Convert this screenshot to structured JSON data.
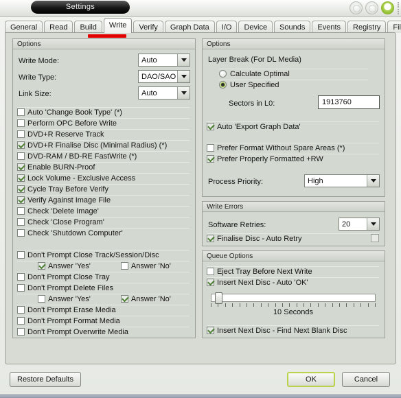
{
  "window": {
    "title": "Settings",
    "controls": [
      {
        "name": "minimize",
        "glyph": ""
      },
      {
        "name": "maximize",
        "glyph": ""
      },
      {
        "name": "close",
        "glyph": "✖"
      }
    ]
  },
  "tabs": [
    {
      "label": "General",
      "active": false
    },
    {
      "label": "Read",
      "active": false
    },
    {
      "label": "Build",
      "active": false
    },
    {
      "label": "Write",
      "active": true
    },
    {
      "label": "Verify",
      "active": false
    },
    {
      "label": "Graph Data",
      "active": false
    },
    {
      "label": "I/O",
      "active": false
    },
    {
      "label": "Device",
      "active": false
    },
    {
      "label": "Sounds",
      "active": false
    },
    {
      "label": "Events",
      "active": false
    },
    {
      "label": "Registry",
      "active": false
    },
    {
      "label": "File Locations",
      "active": false
    }
  ],
  "left_panel": {
    "title": "Options",
    "fields": [
      {
        "label": "Write Mode:",
        "value": "Auto"
      },
      {
        "label": "Write Type:",
        "value": "DAO/SAO"
      },
      {
        "label": "Link Size:",
        "value": "Auto"
      }
    ],
    "checkboxes_group1": [
      {
        "label": "Auto 'Change Book Type' (*)",
        "checked": false
      },
      {
        "label": "Perform OPC Before Write",
        "checked": false
      },
      {
        "label": "DVD+R Reserve Track",
        "checked": false
      },
      {
        "label": "DVD+R Finalise Disc (Minimal Radius) (*)",
        "checked": true
      },
      {
        "label": "DVD-RAM / BD-RE FastWrite (*)",
        "checked": false
      },
      {
        "label": "Enable BURN-Proof",
        "checked": true
      },
      {
        "label": "Lock Volume - Exclusive Access",
        "checked": true
      },
      {
        "label": "Cycle Tray Before Verify",
        "checked": true
      },
      {
        "label": "Verify Against Image File",
        "checked": true
      },
      {
        "label": "Check 'Delete Image'",
        "checked": false
      },
      {
        "label": "Check 'Close Program'",
        "checked": false
      },
      {
        "label": "Check 'Shutdown Computer'",
        "checked": false
      }
    ],
    "checkboxes_group2": [
      {
        "label": "Don't Prompt Close Track/Session/Disc",
        "checked": false
      },
      {
        "label": "Don't Prompt Close Tray",
        "checked": false
      },
      {
        "label": "Don't Prompt Delete Files",
        "checked": false
      },
      {
        "label": "Don't Prompt Erase Media",
        "checked": false
      },
      {
        "label": "Don't Prompt Format Media",
        "checked": false
      },
      {
        "label": "Don't Prompt Overwrite Media",
        "checked": false
      }
    ],
    "answer_rows": [
      {
        "yes_label": "Answer 'Yes'",
        "yes_checked": true,
        "no_label": "Answer 'No'",
        "no_checked": false
      },
      {
        "yes_label": "Answer 'Yes'",
        "yes_checked": false,
        "no_label": "Answer 'No'",
        "no_checked": true
      }
    ]
  },
  "right_panel": {
    "title": "Options",
    "layer_break_label": "Layer Break (For DL Media)",
    "radios": [
      {
        "label": "Calculate Optimal",
        "selected": false
      },
      {
        "label": "User Specified",
        "selected": true
      }
    ],
    "sectors_label": "Sectors in L0:",
    "sectors_value": "1913760",
    "auto_export": {
      "label": "Auto 'Export Graph Data'",
      "checked": true
    },
    "prefer_format": {
      "label": "Prefer Format Without Spare Areas (*)",
      "checked": false
    },
    "prefer_rw": {
      "label": "Prefer Properly Formatted +RW",
      "checked": true
    },
    "process_priority_label": "Process Priority:",
    "process_priority_value": "High"
  },
  "write_errors": {
    "title": "Write Errors",
    "retries_label": "Software Retries:",
    "retries_value": "20",
    "finalise": {
      "label": "Finalise Disc - Auto Retry",
      "checked": true
    },
    "finalise_right_checked": false
  },
  "queue_options": {
    "title": "Queue Options",
    "eject": {
      "label": "Eject Tray Before Next Write",
      "checked": false
    },
    "auto_ok": {
      "label": "Insert Next Disc - Auto 'OK'",
      "checked": true
    },
    "slider_value_label": "10 Seconds",
    "slider_ticks": 24,
    "find_blank": {
      "label": "Insert Next Disc - Find Next Blank Disc",
      "checked": true
    }
  },
  "footer": {
    "restore_defaults": "Restore Defaults",
    "ok": "OK",
    "cancel": "Cancel"
  },
  "colors": {
    "accent_green": "#9dc93c",
    "marker_red": "#e50000",
    "panel_bg": "#d3d8d1"
  }
}
